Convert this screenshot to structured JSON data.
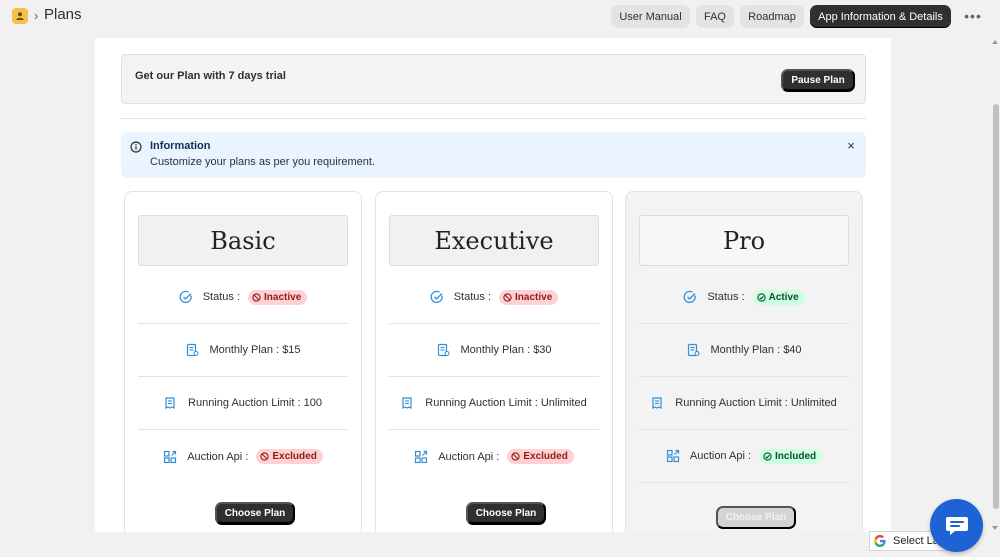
{
  "header": {
    "page_title": "Plans",
    "breadcrumb_separator": "›",
    "buttons": {
      "user_manual": "User Manual",
      "faq": "FAQ",
      "roadmap": "Roadmap",
      "app_info": "App Information & Details"
    },
    "more_icon": "ellipsis-icon"
  },
  "trial": {
    "text": "Get our Plan with 7 days trial",
    "pause_label": "Pause Plan"
  },
  "info_banner": {
    "title": "Information",
    "body": "Customize your plans as per you requirement.",
    "close": "×"
  },
  "plans": [
    {
      "name": "Basic",
      "status_label": "Status :",
      "status": "Inactive",
      "monthly": "Monthly Plan : $15",
      "auction_limit": "Running Auction Limit : 100",
      "api_label": "Auction Api :",
      "api": "Excluded",
      "button": "Choose Plan",
      "active": false
    },
    {
      "name": "Executive",
      "status_label": "Status :",
      "status": "Inactive",
      "monthly": "Monthly Plan : $30",
      "auction_limit": "Running Auction Limit : Unlimited",
      "api_label": "Auction Api :",
      "api": "Excluded",
      "button": "Choose Plan",
      "active": false
    },
    {
      "name": "Pro",
      "status_label": "Status :",
      "status": "Active",
      "monthly": "Monthly Plan : $40",
      "auction_limit": "Running Auction Limit : Unlimited",
      "api_label": "Auction Api :",
      "api": "Included",
      "button": "Choose Plan",
      "active": true
    }
  ],
  "footer": {
    "language_select": "Select La",
    "chat_icon": "chat-icon"
  },
  "colors": {
    "icon_blue": "#2f8fd6",
    "badge_bad_bg": "#fed1d7",
    "badge_good_bg": "#cdfee1",
    "chat_blue": "#1e63d6"
  }
}
